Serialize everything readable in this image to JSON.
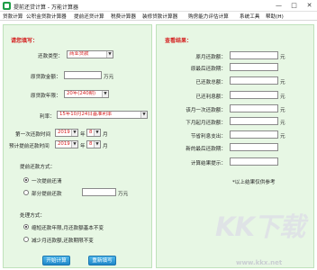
{
  "window": {
    "title": "提前还贷计算 - 万能计算器",
    "min_glyph": "—",
    "max_glyph": "□",
    "close_glyph": "✕"
  },
  "menu": [
    "贷款计算",
    "公积金贷款计算器",
    "提前还贷计算",
    "税费计算器",
    "装修贷款计算器",
    "购房能力评估计算",
    "系统工具",
    "帮助(H)"
  ],
  "form": {
    "section_title": "请您填写：",
    "loan_type_label": "还款类型：",
    "loan_type_value": "商业贷款",
    "amount_label": "原贷款金额：",
    "amount_value": "",
    "amount_unit": "万元",
    "term_label": "原贷款年限：",
    "term_value": "20年(240期)",
    "rate_label": "利率：",
    "rate_value": "15年10月24日基准利率",
    "first_pay_label": "第一次还款时间",
    "first_pay_year": "2019",
    "first_pay_month": "8",
    "prepay_label": "预计提前还款时间",
    "prepay_year": "2019",
    "prepay_month": "8",
    "year_unit": "年",
    "month_unit": "月",
    "prepay_method_label": "提前还款方式：",
    "option_full": "一次提前还清",
    "option_partial": "部分提前还款",
    "partial_unit": "万元",
    "handling_label": "处理方式：",
    "option_shorten": "缩短还款年限,月还款额基本不变",
    "option_reduce": "减少月还款额,还款期限不变",
    "calculate_button": "开始计算",
    "reset_button": "重新填写"
  },
  "results": {
    "section_title": "查看结果：",
    "rows": [
      {
        "label": "原月还款额：",
        "value": "",
        "unit": "元"
      },
      {
        "label": "原最后还款期：",
        "value": "",
        "unit": ""
      },
      {
        "label": "已还款总额：",
        "value": "",
        "unit": "元"
      },
      {
        "label": "已还利息额：",
        "value": "",
        "unit": "元"
      },
      {
        "label": "该月一次还款额：",
        "value": "",
        "unit": "元"
      },
      {
        "label": "下月起月还款额：",
        "value": "",
        "unit": "元"
      },
      {
        "label": "节省利息支出：",
        "value": "",
        "unit": "元"
      },
      {
        "label": "新的最后还款期：",
        "value": "",
        "unit": ""
      },
      {
        "label": "计算结果提示：",
        "value": "",
        "unit": ""
      }
    ],
    "footnote": "*以上结果仅供参考"
  },
  "watermark": {
    "logo": "KK下载",
    "url": "www.kkx.net"
  }
}
